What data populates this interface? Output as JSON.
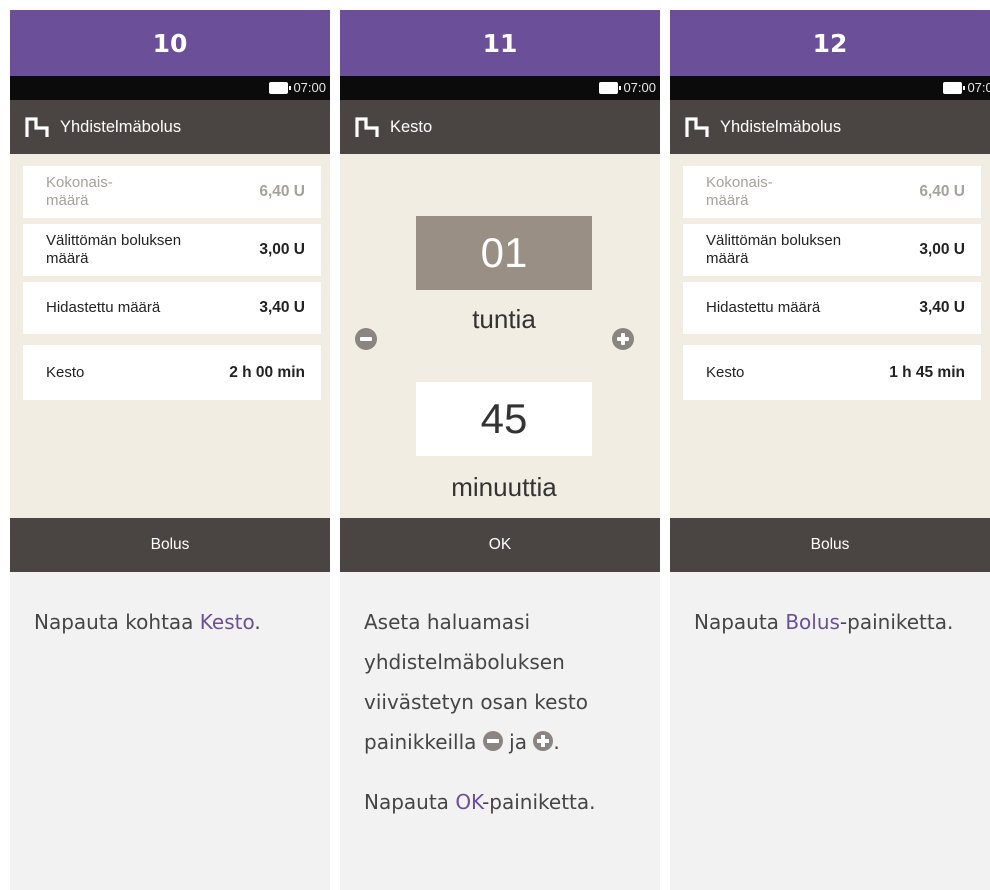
{
  "colors": {
    "accent": "#6b4f99",
    "title_bar": "#4a4542",
    "screen_bg": "#f1ede3",
    "description_bg": "#f2f2f2",
    "hours_box": "#9a8f84",
    "muted_text": "#a5a29c"
  },
  "status_time": "07:00",
  "step10": {
    "number": "10",
    "title": "Yhdistelmäbolus",
    "rows": [
      {
        "label": "Kokonais-\nmäärä",
        "value": "6,40 U"
      },
      {
        "label": "Välittömän boluksen määrä",
        "value": "3,00 U"
      },
      {
        "label": "Hidastettu määrä",
        "value": "3,40 U"
      },
      {
        "label": "Kesto",
        "value": "2 h 00 min"
      }
    ],
    "button": "Bolus",
    "desc": {
      "before": "Napauta kohtaa ",
      "highlight": "Kesto",
      "after": "."
    }
  },
  "step11": {
    "number": "11",
    "title": "Kesto",
    "hours_value": "01",
    "hours_label": "tuntia",
    "minutes_value": "45",
    "minutes_label": "minuuttia",
    "button": "OK",
    "desc": {
      "para1_before": "Aseta haluamasi yhdistelmäboluksen viivästetyn osan kesto painikkeilla ",
      "para1_mid": " ja ",
      "para1_after": ".",
      "para2_before": "Napauta ",
      "para2_highlight": "OK",
      "para2_after": "-painiketta."
    }
  },
  "step12": {
    "number": "12",
    "title": "Yhdistelmäbolus",
    "rows": [
      {
        "label": "Kokonais-\nmäärä",
        "value": "6,40 U"
      },
      {
        "label": "Välittömän boluksen määrä",
        "value": "3,00 U"
      },
      {
        "label": "Hidastettu määrä",
        "value": "3,40 U"
      },
      {
        "label": "Kesto",
        "value": "1 h 45 min"
      }
    ],
    "button": "Bolus",
    "desc": {
      "before": "Napauta ",
      "highlight": "Bolus",
      "after": "-painiketta."
    }
  },
  "icons": {
    "title_icon": "combo-bolus-icon",
    "battery": "battery-icon",
    "minus": "minus-circle-icon",
    "plus": "plus-circle-icon"
  }
}
